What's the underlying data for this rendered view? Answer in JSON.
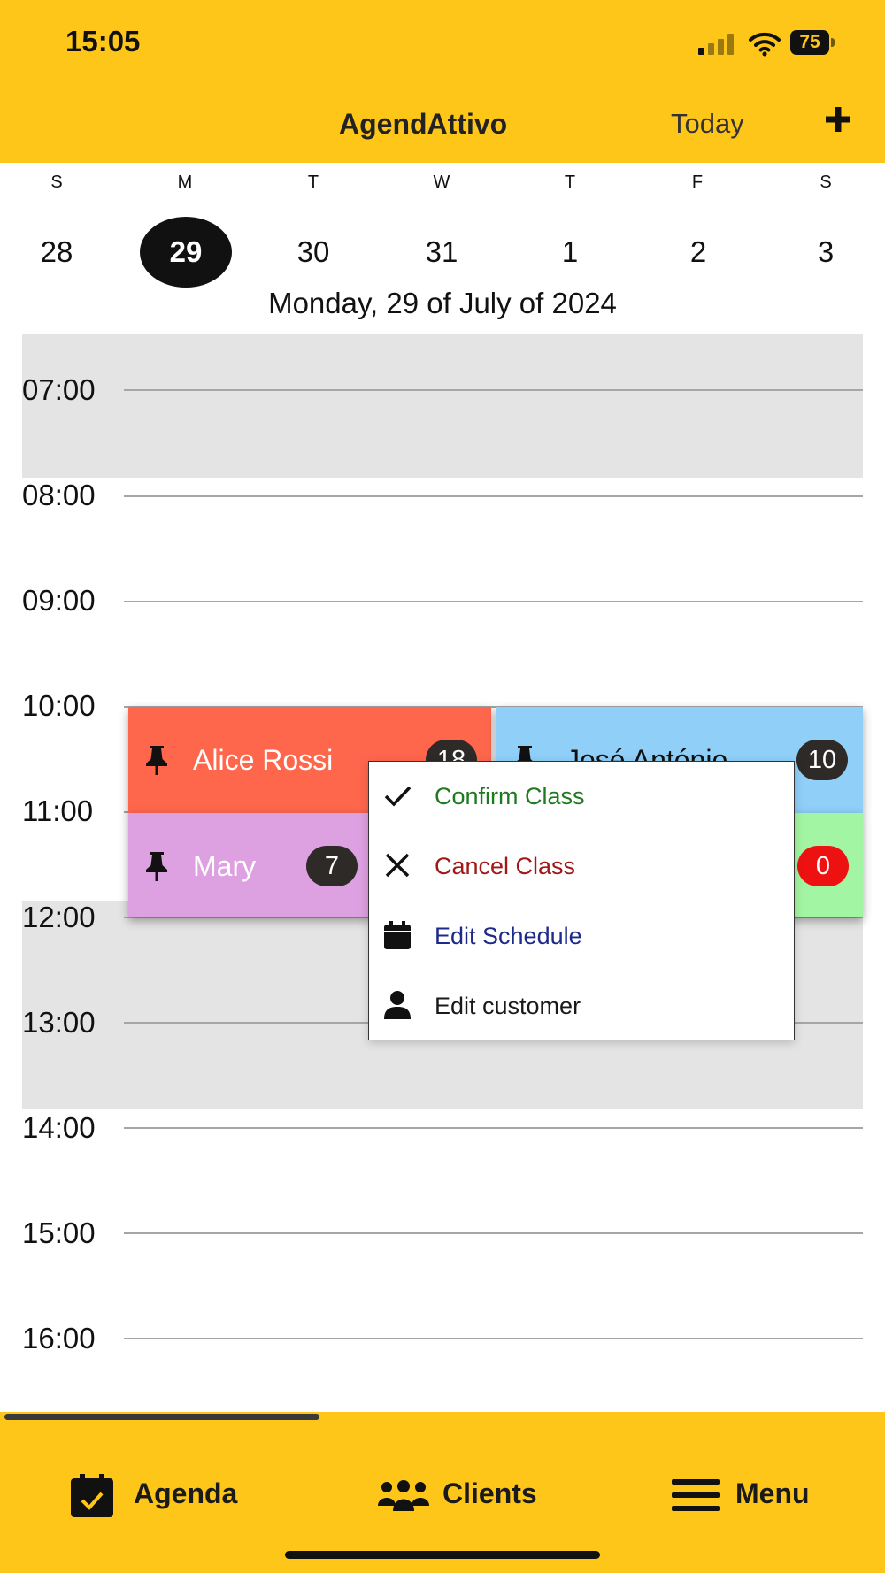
{
  "status_bar": {
    "time": "15:05",
    "battery": "75"
  },
  "header": {
    "title": "AgendAttivo",
    "today_label": "Today"
  },
  "week": {
    "days": [
      {
        "letter": "S",
        "number": "28"
      },
      {
        "letter": "M",
        "number": "29"
      },
      {
        "letter": "T",
        "number": "30"
      },
      {
        "letter": "W",
        "number": "31"
      },
      {
        "letter": "T",
        "number": "1"
      },
      {
        "letter": "F",
        "number": "2"
      },
      {
        "letter": "S",
        "number": "3"
      }
    ],
    "selected_index": 1
  },
  "date_heading": "Monday, 29 of July of 2024",
  "timeline": {
    "hours": [
      "07:00",
      "08:00",
      "09:00",
      "10:00",
      "11:00",
      "12:00",
      "13:00",
      "14:00",
      "15:00",
      "16:00"
    ]
  },
  "events": [
    {
      "name": "Alice Rossi",
      "count": "18",
      "color": "#FF674D"
    },
    {
      "name": "José António",
      "count": "10",
      "color": "#8FCFF8"
    },
    {
      "name": "Mary",
      "count": "7",
      "color": "#DDA0E0"
    },
    {
      "name": "",
      "count": "0",
      "color": "#A2F5A2"
    }
  ],
  "context_menu": {
    "items": [
      {
        "label": "Confirm Class",
        "icon": "check-icon",
        "color": "#1f7a1f"
      },
      {
        "label": "Cancel Class",
        "icon": "close-icon",
        "color": "#a01818"
      },
      {
        "label": "Edit Schedule",
        "icon": "calendar-icon",
        "color": "#1e2a8a"
      },
      {
        "label": "Edit customer",
        "icon": "person-icon",
        "color": "#1a1a1a"
      }
    ]
  },
  "bottom_nav": {
    "items": [
      {
        "label": "Agenda",
        "icon": "calendar-check-icon"
      },
      {
        "label": "Clients",
        "icon": "people-group-icon"
      },
      {
        "label": "Menu",
        "icon": "hamburger-menu-icon"
      }
    ]
  },
  "colors": {
    "accent": "#FFC61A",
    "shaded_hours": "#E4E4E4",
    "selected_day": "#111111"
  }
}
